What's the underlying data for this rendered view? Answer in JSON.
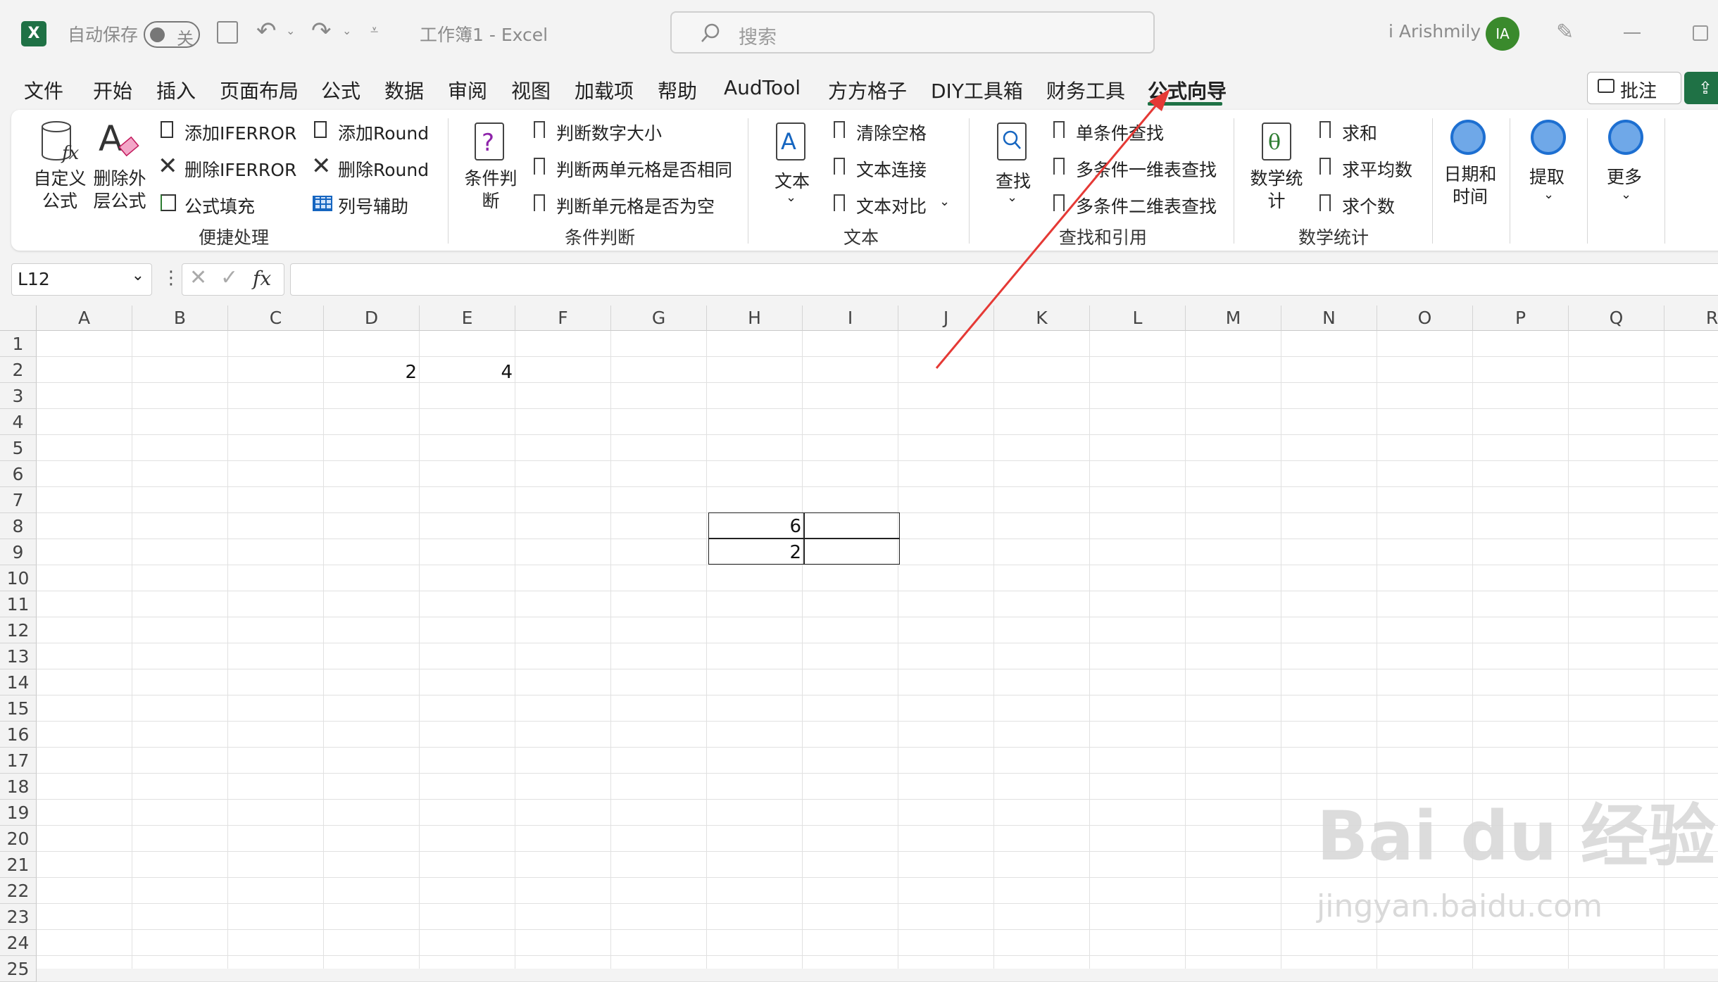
{
  "title_bar": {
    "autosave_label": "自动保存",
    "autosave_state": "关",
    "doc_title": "工作簿1  -  Excel",
    "search_placeholder": "搜索",
    "user_name": "i Arishmily",
    "avatar_initials": "IA"
  },
  "tabs": [
    {
      "label": "文件"
    },
    {
      "label": "开始"
    },
    {
      "label": "插入"
    },
    {
      "label": "页面布局"
    },
    {
      "label": "公式"
    },
    {
      "label": "数据"
    },
    {
      "label": "审阅"
    },
    {
      "label": "视图"
    },
    {
      "label": "加载项"
    },
    {
      "label": "帮助"
    },
    {
      "label": "AudTool"
    },
    {
      "label": "方方格子"
    },
    {
      "label": "DIY工具箱"
    },
    {
      "label": "财务工具"
    },
    {
      "label": "公式向导"
    }
  ],
  "comment_button": "批注",
  "ribbon": {
    "g1": {
      "label": "便捷处理",
      "custom_formula": "自定义公式",
      "delete_outer": "删除外层公式",
      "add_iferror": "添加IFERROR",
      "del_iferror": "删除IFERROR",
      "formula_fill": "公式填充",
      "add_round": "添加Round",
      "del_round": "删除Round",
      "col_helper": "列号辅助"
    },
    "g2": {
      "label": "条件判断",
      "cond_judge": "条件判断",
      "judge_num": "判断数字大小",
      "judge_same": "判断两单元格是否相同",
      "judge_empty": "判断单元格是否为空"
    },
    "g3": {
      "label": "文本",
      "text": "文本",
      "clear_space": "清除空格",
      "text_concat": "文本连接",
      "text_compare": "文本对比"
    },
    "g4": {
      "label": "查找和引用",
      "find": "查找",
      "single_lookup": "单条件查找",
      "multi_1d": "多条件一维表查找",
      "multi_2d": "多条件二维表查找"
    },
    "g5": {
      "label": "数学统计",
      "math_stats": "数学统计",
      "sum": "求和",
      "average": "求平均数",
      "count": "求个数"
    },
    "g6": {
      "date_time": "日期和时间"
    },
    "g7": {
      "extract": "提取"
    },
    "g8": {
      "more": "更多"
    }
  },
  "name_box": "L12",
  "columns": [
    "A",
    "B",
    "C",
    "D",
    "E",
    "F",
    "G",
    "H",
    "I",
    "J",
    "K",
    "L",
    "M",
    "N",
    "O",
    "P",
    "Q",
    "R"
  ],
  "rows": [
    "1",
    "2",
    "3",
    "4",
    "5",
    "6",
    "7",
    "8",
    "9",
    "10",
    "11",
    "12",
    "13",
    "14",
    "15",
    "16",
    "17",
    "18",
    "19",
    "20",
    "21",
    "22",
    "23",
    "24",
    "25"
  ],
  "cells": {
    "D2": "2",
    "E2": "4",
    "H8": "6",
    "H9": "2"
  },
  "watermark": {
    "brand": "Bai du 经验",
    "url": "jingyan.baidu.com"
  },
  "colors": {
    "excel_green": "#1f7145",
    "arrow_red": "#e53935",
    "accent_blue": "#2f7fd8"
  }
}
